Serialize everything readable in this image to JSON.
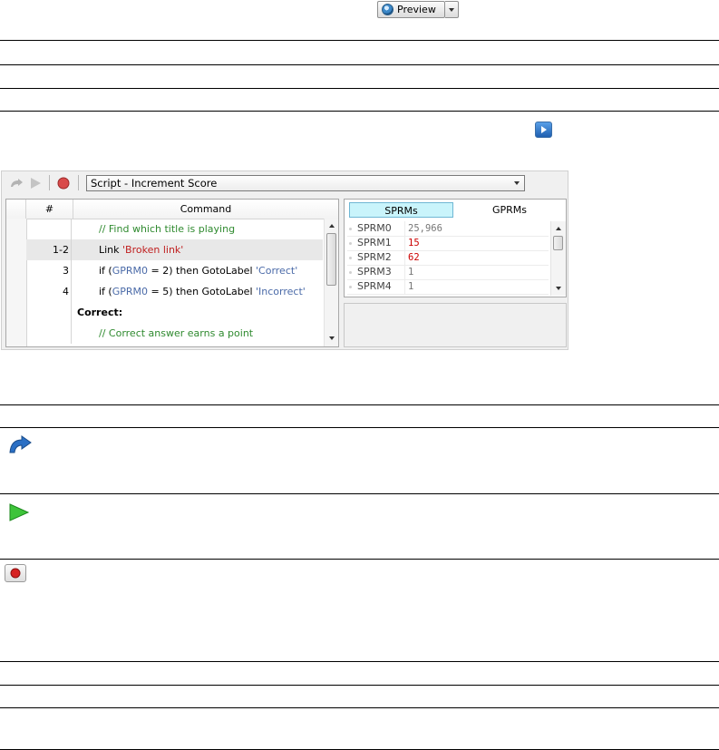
{
  "preview": {
    "label": "Preview"
  },
  "debugger": {
    "script_select": "Script - Increment Score",
    "columns": {
      "num": "#",
      "command": "Command"
    },
    "rows": [
      {
        "num": "",
        "parts": [
          {
            "t": "// Find which title is playing",
            "c": "cmt"
          }
        ]
      },
      {
        "num": "1-2",
        "parts": [
          {
            "t": "Link ",
            "c": ""
          },
          {
            "t": "'Broken link'",
            "c": "str"
          }
        ]
      },
      {
        "num": "3",
        "parts": [
          {
            "t": "if (",
            "c": ""
          },
          {
            "t": "GPRM0",
            "c": "var"
          },
          {
            "t": " = 2) then GotoLabel ",
            "c": ""
          },
          {
            "t": "'Correct'",
            "c": "var"
          }
        ]
      },
      {
        "num": "4",
        "parts": [
          {
            "t": "if (",
            "c": ""
          },
          {
            "t": "GPRM0",
            "c": "var"
          },
          {
            "t": " = 5) then GotoLabel ",
            "c": ""
          },
          {
            "t": "'Incorrect'",
            "c": "var"
          }
        ]
      },
      {
        "num": "",
        "label": "Correct:"
      },
      {
        "num": "",
        "parts": [
          {
            "t": "// Correct answer earns a point",
            "c": "cmt"
          }
        ]
      }
    ],
    "tabs": {
      "sprm": "SPRMs",
      "gprm": "GPRMs"
    },
    "registers": [
      {
        "name": "SPRM0",
        "value": "25,966",
        "color": "#777777"
      },
      {
        "name": "SPRM1",
        "value": "15",
        "color": "#cc0000"
      },
      {
        "name": "SPRM2",
        "value": "62",
        "color": "#cc0000"
      },
      {
        "name": "SPRM3",
        "value": "1",
        "color": "#777777"
      },
      {
        "name": "SPRM4",
        "value": "1",
        "color": "#777777"
      }
    ]
  },
  "icons": {
    "preview": "disc-icon",
    "play_small": "play-blue-icon",
    "step": "step-over-icon",
    "run": "run-icon",
    "stop": "stop-icon"
  }
}
